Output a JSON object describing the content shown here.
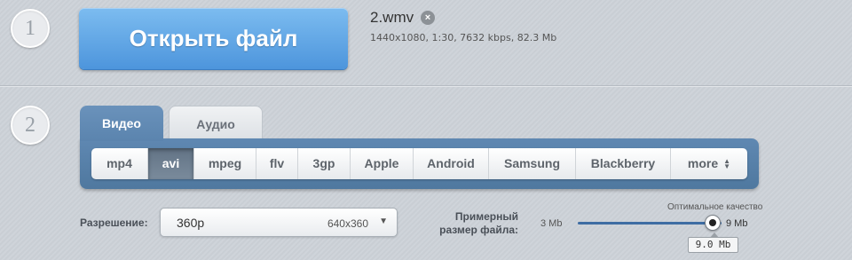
{
  "step1": {
    "number": "1",
    "open_button_label": "Открыть файл",
    "file_name": "2.wmv",
    "remove_icon": "close-circle-icon",
    "file_meta": "1440x1080, 1:30, 7632 kbps, 82.3 Mb"
  },
  "step2": {
    "number": "2",
    "tabs": [
      {
        "label": "Видео",
        "active": true
      },
      {
        "label": "Аудио",
        "active": false
      }
    ],
    "formats": [
      {
        "label": "mp4",
        "active": false
      },
      {
        "label": "avi",
        "active": true
      },
      {
        "label": "mpeg",
        "active": false
      },
      {
        "label": "flv",
        "active": false
      },
      {
        "label": "3gp",
        "active": false
      },
      {
        "label": "Apple",
        "active": false
      },
      {
        "label": "Android",
        "active": false
      },
      {
        "label": "Samsung",
        "active": false
      },
      {
        "label": "Blackberry",
        "active": false
      },
      {
        "label": "more",
        "active": false
      }
    ],
    "resolution": {
      "label": "Разрешение:",
      "value": "360p",
      "dimensions": "640x360"
    },
    "file_size": {
      "label_line1": "Примерный",
      "label_line2": "размер файла:",
      "min_label": "3 Mb",
      "max_label": "9 Mb",
      "quality_caption": "Оптимальное качество",
      "current_value": "9.0 Mb",
      "slider_fraction": 1.0
    }
  },
  "colors": {
    "accent_blue": "#5a9be0",
    "panel_blue": "#5b84ae",
    "active_format": "#6b7c8e"
  }
}
